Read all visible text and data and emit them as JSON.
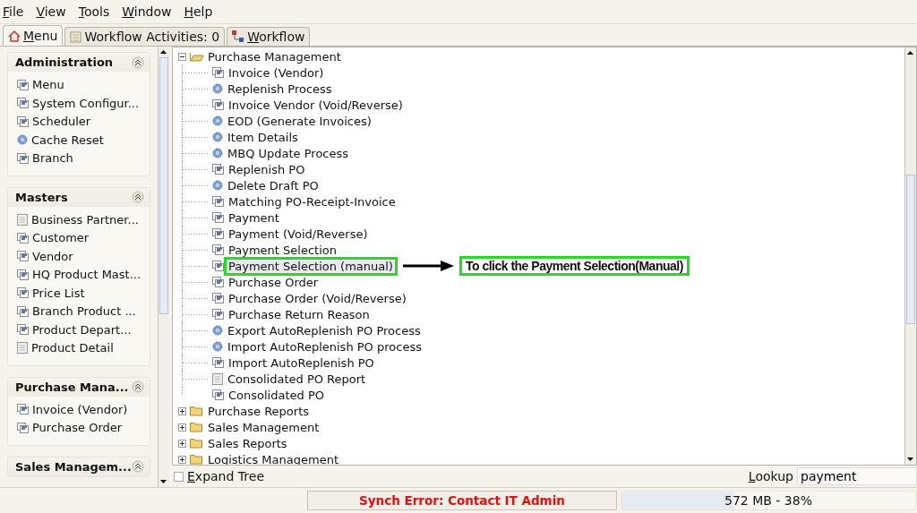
{
  "menu_bar": [
    {
      "label": "File"
    },
    {
      "label": "View"
    },
    {
      "label": "Tools"
    },
    {
      "label": "Window"
    },
    {
      "label": "Help"
    }
  ],
  "tabs": [
    {
      "label": "Menu",
      "selected": true
    },
    {
      "label": "Workflow Activities: 0",
      "selected": false
    },
    {
      "label": "Workflow",
      "selected": false
    }
  ],
  "sidebar": {
    "panels": [
      {
        "title": "Administration",
        "items": [
          {
            "label": "Menu",
            "kind": "window"
          },
          {
            "label": "System Configur...",
            "kind": "window"
          },
          {
            "label": "Scheduler",
            "kind": "window"
          },
          {
            "label": "Cache Reset",
            "kind": "process"
          },
          {
            "label": "Branch",
            "kind": "window"
          }
        ]
      },
      {
        "title": "Masters",
        "items": [
          {
            "label": "Business Partner...",
            "kind": "report"
          },
          {
            "label": "Customer",
            "kind": "window"
          },
          {
            "label": "Vendor",
            "kind": "window"
          },
          {
            "label": "HQ Product Mast...",
            "kind": "window"
          },
          {
            "label": "Price List",
            "kind": "window"
          },
          {
            "label": "Branch Product ...",
            "kind": "window"
          },
          {
            "label": "Product Depart...",
            "kind": "window"
          },
          {
            "label": "Product Detail",
            "kind": "report"
          }
        ]
      },
      {
        "title": "Purchase Mana...",
        "items": [
          {
            "label": "Invoice (Vendor)",
            "kind": "window"
          },
          {
            "label": "Purchase Order",
            "kind": "window"
          }
        ]
      },
      {
        "title": "Sales Managem..."
      }
    ]
  },
  "tree": [
    {
      "label": "Purchase Management",
      "expanded": true,
      "children": [
        {
          "label": "Invoice (Vendor)",
          "kind": "window",
          "selected": false
        },
        {
          "label": "Replenish Process",
          "kind": "process",
          "selected": false
        },
        {
          "label": "Invoice Vendor (Void/Reverse)",
          "kind": "window",
          "selected": false
        },
        {
          "label": "EOD (Generate Invoices)",
          "kind": "process",
          "selected": false
        },
        {
          "label": "Item Details",
          "kind": "process",
          "selected": false
        },
        {
          "label": "MBQ Update Process",
          "kind": "process",
          "selected": false
        },
        {
          "label": "Replenish PO",
          "kind": "window",
          "selected": false
        },
        {
          "label": "Delete Draft PO",
          "kind": "process",
          "selected": false
        },
        {
          "label": "Matching PO-Receipt-Invoice",
          "kind": "window",
          "selected": false
        },
        {
          "label": "Payment",
          "kind": "window",
          "selected": false
        },
        {
          "label": "Payment (Void/Reverse)",
          "kind": "window",
          "selected": false
        },
        {
          "label": "Payment Selection",
          "kind": "window",
          "selected": false
        },
        {
          "label": "Payment Selection (manual)",
          "kind": "window",
          "selected": true,
          "annotation": "To click the Payment Selection(Manual)"
        },
        {
          "label": "Purchase Order",
          "kind": "window",
          "selected": false
        },
        {
          "label": "Purchase Order (Void/Reverse)",
          "kind": "window",
          "selected": false
        },
        {
          "label": "Purchase Return Reason",
          "kind": "window",
          "selected": false
        },
        {
          "label": "Export AutoReplenish PO Process",
          "kind": "process",
          "selected": false
        },
        {
          "label": "Import AutoReplenish PO process",
          "kind": "process",
          "selected": false
        },
        {
          "label": "Import AutoReplenish PO",
          "kind": "window",
          "selected": false
        },
        {
          "label": "Consolidated PO Report",
          "kind": "report",
          "selected": false
        },
        {
          "label": "Consolidated PO",
          "kind": "window",
          "selected": false
        }
      ]
    },
    {
      "label": "Purchase Reports",
      "expanded": false
    },
    {
      "label": "Sales Management",
      "expanded": false
    },
    {
      "label": "Sales Reports",
      "expanded": false
    },
    {
      "label": "Logistics Management",
      "expanded": false
    }
  ],
  "expand_tree": {
    "label": "Expand Tree",
    "checked": false
  },
  "lookup": {
    "label": "Lookup",
    "value": "payment"
  },
  "status_bar": {
    "message": "Synch Error: Contact IT Admin",
    "memory": "572 MB - 38%",
    "level": 0.38
  }
}
